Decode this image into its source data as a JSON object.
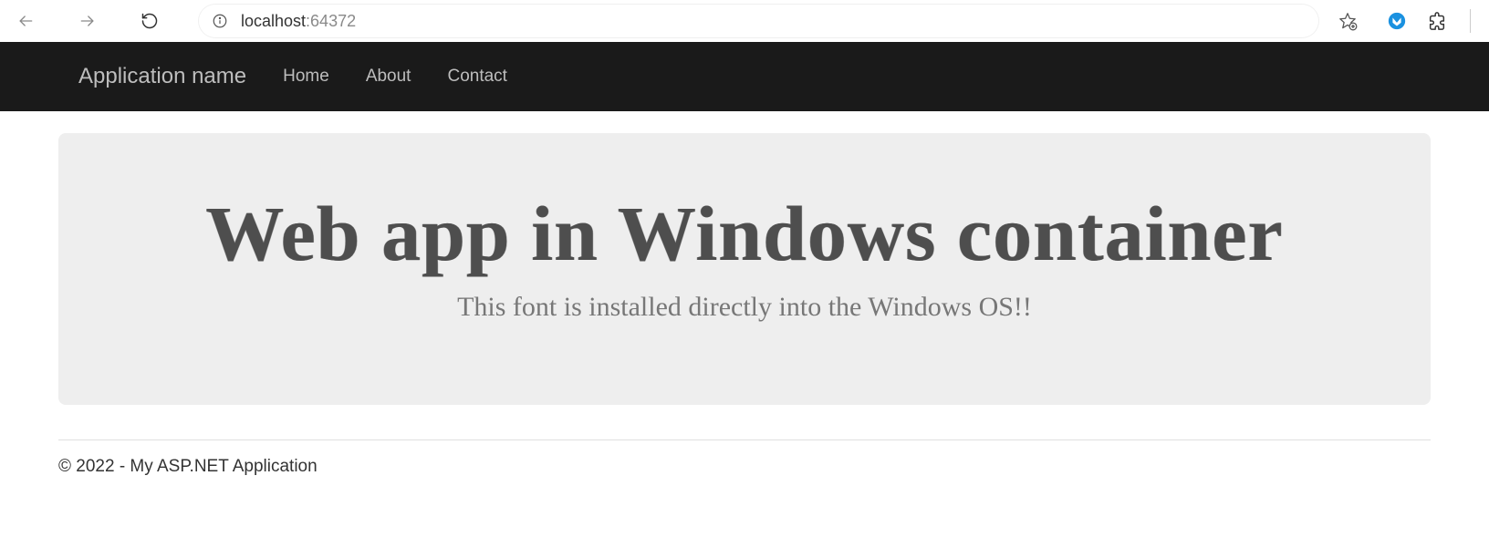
{
  "browser": {
    "url_host": "localhost",
    "url_port": ":64372"
  },
  "navbar": {
    "brand": "Application name",
    "links": [
      "Home",
      "About",
      "Contact"
    ]
  },
  "hero": {
    "title": "Web app in Windows container",
    "subtitle": "This font is installed directly into the Windows OS!!"
  },
  "footer": {
    "text": "© 2022 - My ASP.NET Application"
  }
}
